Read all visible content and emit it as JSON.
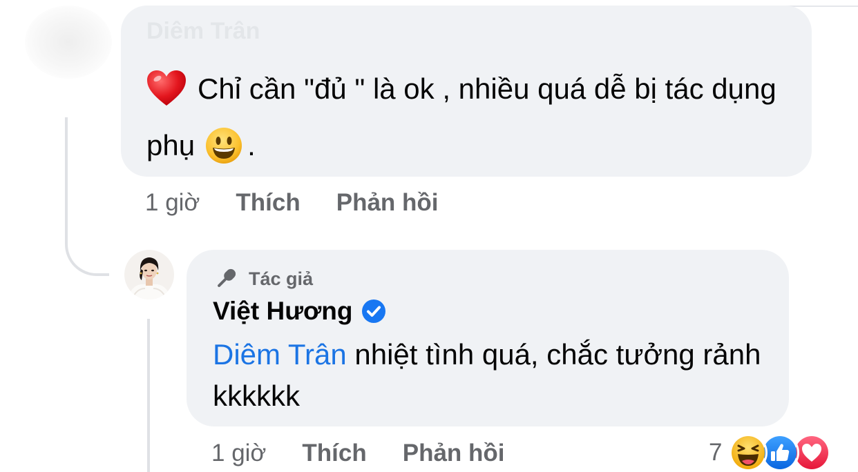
{
  "colors": {
    "bubble_bg": "#f0f2f5",
    "meta_text": "#65676b",
    "mention_link": "#1b74e4",
    "verified_badge": "#1877f2",
    "thread_line": "#dfe1e5"
  },
  "comment_1": {
    "author": "Diêm Trân",
    "leading_emoji": "red-heart-emoji",
    "text_part_1": "Chỉ cần \"đủ \" là ok , nhiều quá dễ bị tác dụng phụ",
    "trailing_emoji": "smiling-face-emoji",
    "text_part_2": ".",
    "time": "1 giờ",
    "like_label": "Thích",
    "reply_label": "Phản hồi"
  },
  "comment_2": {
    "author_badge_icon": "microphone-icon",
    "author_badge_label": "Tác giả",
    "author": "Việt Hương",
    "verified_icon": "verified-check-icon",
    "mention": "Diêm Trân",
    "text": " nhiệt tình quá, chắc tưởng rảnh kkkkkk",
    "time": "1 giờ",
    "like_label": "Thích",
    "reply_label": "Phản hồi",
    "reaction_count": "7",
    "reaction_icons": [
      "haha-reaction-icon",
      "like-reaction-icon",
      "love-reaction-icon"
    ]
  }
}
